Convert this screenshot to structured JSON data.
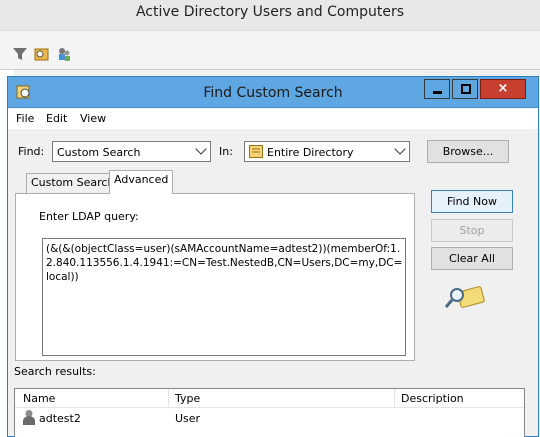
{
  "app": {
    "title": "Active Directory Users and Computers"
  },
  "dialog": {
    "title": "Find Custom Search",
    "close_glyph": "×",
    "menu": [
      "File",
      "Edit",
      "View"
    ],
    "find_label": "Find:",
    "find_value": "Custom Search",
    "in_label": "In:",
    "in_value": "Entire Directory",
    "browse_label": "Browse...",
    "tabs": [
      "Custom Search",
      "Advanced"
    ],
    "active_tab": "Advanced",
    "ldap_label": "Enter LDAP query:",
    "ldap_query": "(&(&(objectClass=user)(sAMAccountName=adtest2))(memberOf:1.2.840.113556.1.4.1941:=CN=Test.NestedB,CN=Users,DC=my,DC=local))",
    "buttons": {
      "find_now": "Find Now",
      "stop": "Stop",
      "clear_all": "Clear All"
    },
    "results_label": "Search results:",
    "columns": [
      "Name",
      "Type",
      "Description"
    ],
    "rows": [
      {
        "name": "adtest2",
        "type": "User",
        "description": ""
      }
    ]
  },
  "colors": {
    "titlebar": "#5fa7e3",
    "close": "#c7402f",
    "default_button_border": "#3c7fb1"
  }
}
